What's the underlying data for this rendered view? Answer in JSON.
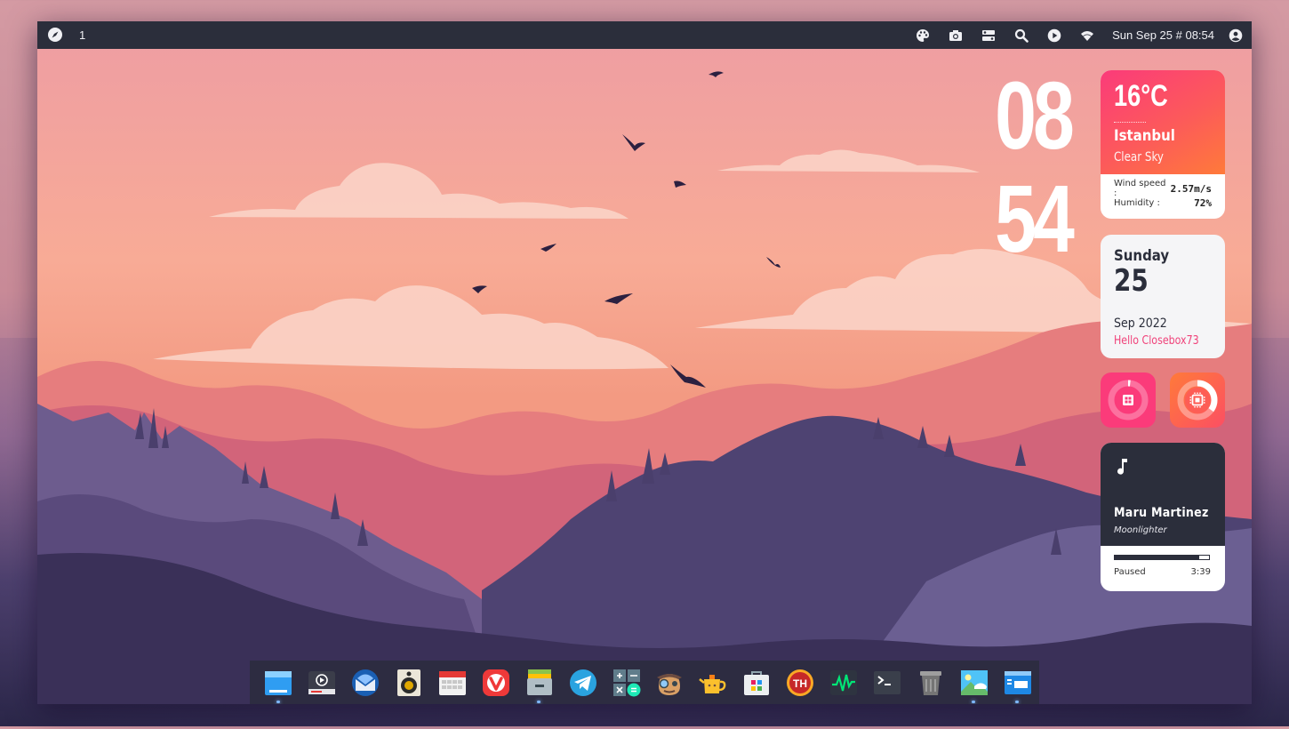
{
  "topbar": {
    "workspace": "1",
    "datetime": "Sun Sep 25 # 08:54",
    "icons": [
      "compass-icon",
      "palette-icon",
      "camera-icon",
      "switch-icon",
      "search-icon",
      "play-icon",
      "wifi-icon",
      "user-icon"
    ]
  },
  "clock": {
    "hour": "08",
    "minute": "54"
  },
  "weather": {
    "temp": "16°C",
    "city": "Istanbul",
    "desc": "Clear Sky",
    "wind_label": "Wind speed :",
    "wind_value": "2.57m/s",
    "humidity_label": "Humidity :",
    "humidity_value": "72%"
  },
  "date": {
    "day": "Sunday",
    "num": "25",
    "month": "Sep 2022",
    "hello": "Hello Closebox73"
  },
  "system": {
    "ram_icon": "memory-icon",
    "cpu_icon": "cpu-icon",
    "ram_fraction": 0.02,
    "cpu_fraction": 0.35
  },
  "music": {
    "artist": "Maru Martinez",
    "title": "Moonlighter",
    "status": "Paused",
    "time": "3:39",
    "progress": 0.9
  },
  "dock": {
    "items": [
      {
        "name": "file-manager-icon",
        "running": true
      },
      {
        "name": "video-player-icon",
        "running": false
      },
      {
        "name": "thunderbird-icon",
        "running": false
      },
      {
        "name": "rhythmbox-icon",
        "running": false
      },
      {
        "name": "calendar-icon",
        "running": false
      },
      {
        "name": "vivaldi-icon",
        "running": false
      },
      {
        "name": "archive-icon",
        "running": true
      },
      {
        "name": "telegram-icon",
        "running": false
      },
      {
        "name": "calculator-icon",
        "running": false
      },
      {
        "name": "detective-icon",
        "running": false
      },
      {
        "name": "teapot-icon",
        "running": false
      },
      {
        "name": "app-center-icon",
        "running": false
      },
      {
        "name": "timeshift-icon",
        "running": false
      },
      {
        "name": "system-monitor-icon",
        "running": false
      },
      {
        "name": "terminal-icon",
        "running": false
      },
      {
        "name": "trash-icon",
        "running": false
      },
      {
        "name": "image-viewer-icon",
        "running": true
      },
      {
        "name": "window-icon",
        "running": true
      }
    ]
  },
  "colors": {
    "bar": "#2b2e3b",
    "pink": "#fb3b7a",
    "orange": "#ff7a3a"
  }
}
